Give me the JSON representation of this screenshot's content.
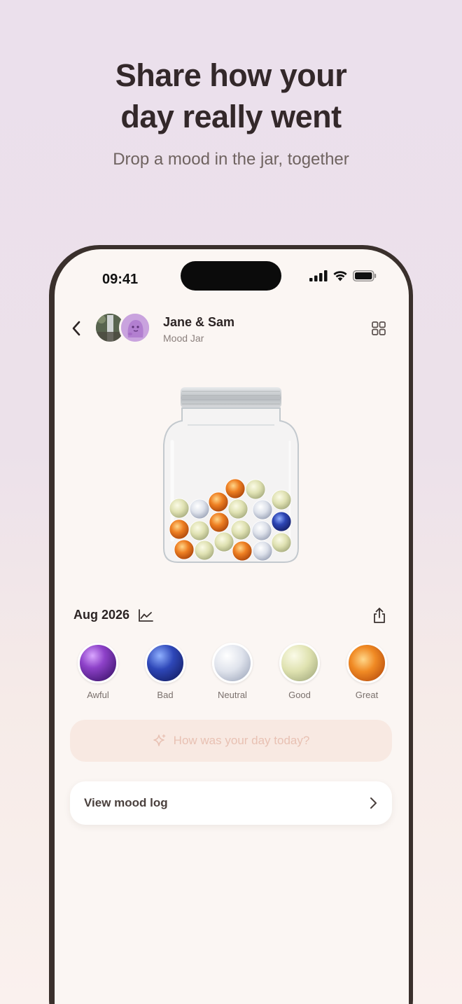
{
  "hero": {
    "headline_line1": "Share how your",
    "headline_line2": "day really went",
    "subtitle": "Drop a mood in the jar, together"
  },
  "status_bar": {
    "time": "09:41"
  },
  "header": {
    "title": "Jane & Sam",
    "subtitle": "Mood Jar",
    "back_icon": "chevron-left-icon",
    "menu_icon": "grid-icon"
  },
  "month_row": {
    "label": "Aug 2026",
    "chart_icon": "line-chart-icon",
    "share_icon": "share-icon"
  },
  "moods": [
    {
      "label": "Awful"
    },
    {
      "label": "Bad"
    },
    {
      "label": "Neutral"
    },
    {
      "label": "Good"
    },
    {
      "label": "Great"
    }
  ],
  "prompt_button": {
    "label": "How was your day today?",
    "icon": "sparkle-icon"
  },
  "log_button": {
    "label": "View mood log",
    "icon": "chevron-right-icon"
  },
  "colors": {
    "accent_soft": "#f8e9e2",
    "prompt_text": "#e8c1b3",
    "screen_bg": "#fbf6f3",
    "frame": "#3a302c"
  }
}
